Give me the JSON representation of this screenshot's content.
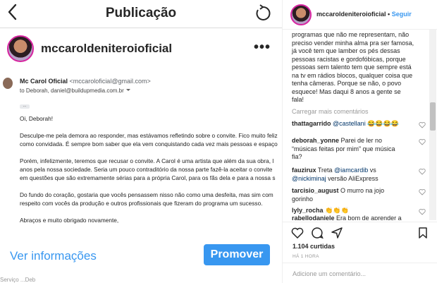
{
  "post": {
    "title": "Publicação",
    "username": "mccaroldeniteroioficial",
    "email": {
      "sender_name": "Mc Carol Oficial",
      "sender_email": "<mccaroloficial@gmail.com>",
      "to_line": "to Deborah, daniel@buildupmedia.com.br",
      "ellipsis": "...",
      "paragraphs": [
        "Oi, Deborah!",
        "Desculpe-me pela demora ao responder, mas estávamos refletindo sobre o convite. Fico muito feliz",
        "como convidada. É sempre bom saber que ela vem conquistando cada vez mais pessoas e espaço",
        "Porém, infelizmente, teremos que recusar o convite. A Carol é uma artista que além da sua obra, l",
        "anos pela nossa sociedade. Seria um pouco contraditório da nossa parte fazê-la aceitar o convite",
        "em questões que são extremamente sérias para a própria Carol, para os fãs dela e para a nossa s",
        "Do fundo do coração, gostaria que vocês pensassem nisso não como uma desfeita, mas sim com",
        "respeito com vocês da produção e outros profissionais que fizeram do programa um sucesso.",
        "Abraços e muito obrigado novamente,"
      ]
    },
    "ver_info_label": "Ver informações",
    "promote_label": "Promover",
    "bottom_fragment": "Serviço ...Deb"
  },
  "panel": {
    "username": "mccaroldeniteroioficial",
    "separator": " • ",
    "follow_label": "Seguir",
    "caption_lines": [
      "programas que não me representam, não",
      "preciso vender minha alma pra ser famosa,",
      "já você tem que lamber os pés dessas",
      "pessoas racistas e gordofóbicas, porque",
      "pessoas sem talento tem que sempre está",
      "na tv em rádios blocos, qualquer coisa que",
      "tenha câmeras. Porque se não, o povo",
      "esquece! Mas daqui 8 anos a gente se",
      "fala!"
    ],
    "load_more": "Carregar mais comentários",
    "comments": [
      {
        "user": "thattagarrido",
        "mention": "@castellani",
        "text": " 😂😂😂😂"
      },
      {
        "user": "deborah_yonne",
        "mention": "",
        "text": "Parei de ler no",
        "text2": "“músicas feitas por mim” que música",
        "text3": "fia?"
      },
      {
        "user": "fauzirux",
        "mention": "@iamcardib",
        "text": "Treta ",
        "after": " vs",
        "mention2": "@nickiminaj",
        "text2": " versão AliExpress"
      },
      {
        "user": "tarcisio_august",
        "mention": "",
        "text": "O murro na jojo",
        "text2": "gorinho"
      },
      {
        "user": "lyly_rocha",
        "mention": "",
        "text": "👏👏👏"
      },
      {
        "user": "rabellodaniele",
        "mention": "",
        "text": "Era bom de aprender a"
      }
    ],
    "likes": "1.104 curtidas",
    "time": "HÁ 1 HORA",
    "add_comment_placeholder": "Adicione um comentário..."
  },
  "icons": {
    "back": "chevron-left-icon",
    "refresh": "refresh-icon",
    "more": "more-dots-icon",
    "heart": "heart-icon",
    "comment": "comment-icon",
    "share": "share-icon",
    "bookmark": "bookmark-icon"
  },
  "colors": {
    "accent": "#3897f0",
    "text": "#262626",
    "muted": "#999999"
  }
}
